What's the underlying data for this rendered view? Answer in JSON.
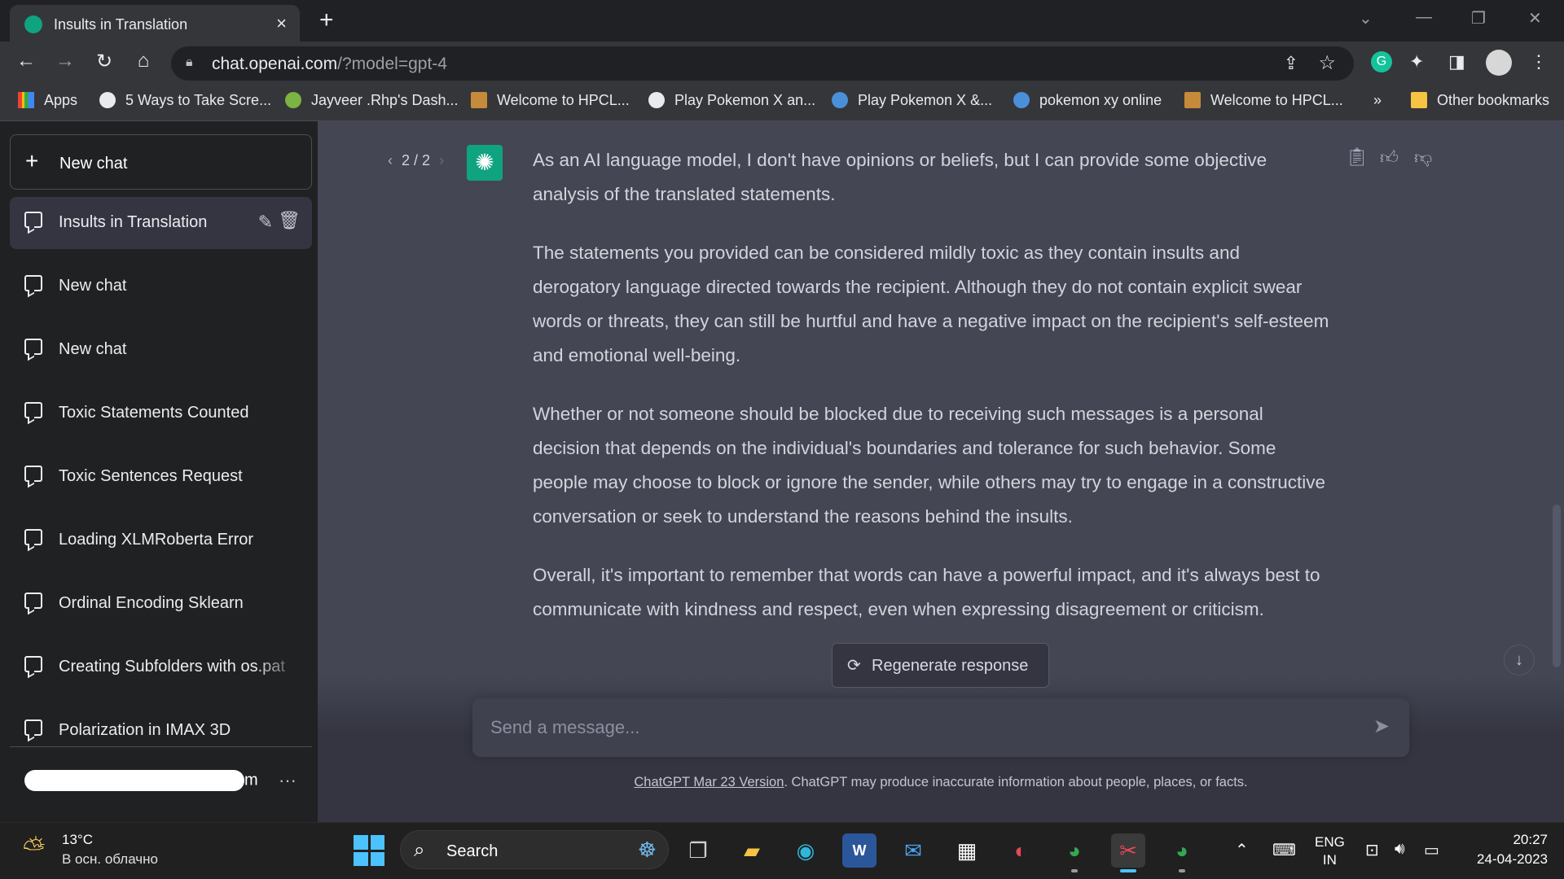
{
  "browser": {
    "tab_title": "Insults in Translation",
    "url_host": "chat.openai.com",
    "url_path": "/?model=gpt-4",
    "bookmarks": [
      {
        "label": "Apps",
        "color": "#ea4335"
      },
      {
        "label": "5 Ways to Take Scre...",
        "color": "#e8eaed"
      },
      {
        "label": "Jayveer .Rhp's Dash...",
        "color": "#7cb342"
      },
      {
        "label": "Welcome to HPCL...",
        "color": "#c58b3a"
      },
      {
        "label": "Play Pokemon X an...",
        "color": "#e8eaed"
      },
      {
        "label": "Play Pokemon X &...",
        "color": "#4a90d9"
      },
      {
        "label": "pokemon xy online",
        "color": "#4a90d9"
      },
      {
        "label": "Welcome to HPCL...",
        "color": "#c58b3a"
      }
    ],
    "bookmarks_overflow": "»",
    "other_bookmarks": "Other bookmarks"
  },
  "sidebar": {
    "new_chat": "New chat",
    "chats": [
      {
        "label": "Insults in Translation",
        "active": true
      },
      {
        "label": "New chat"
      },
      {
        "label": "New chat"
      },
      {
        "label": "Toxic Statements Counted"
      },
      {
        "label": "Toxic Sentences Request"
      },
      {
        "label": "Loading XLMRoberta Error"
      },
      {
        "label": "Ordinal Encoding Sklearn"
      },
      {
        "label": "Creating Subfolders with os.pat"
      },
      {
        "label": "Polarization in IMAX 3D"
      }
    ],
    "account_suffix": "m",
    "more": "···"
  },
  "main": {
    "pager": "2 / 2",
    "paragraphs": [
      "As an AI language model, I don't have opinions or beliefs, but I can provide some objective analysis of the translated statements.",
      "The statements you provided can be considered mildly toxic as they contain insults and derogatory language directed towards the recipient. Although they do not contain explicit swear words or threats, they can still be hurtful and have a negative impact on the recipient's self-esteem and emotional well-being.",
      "Whether or not someone should be blocked due to receiving such messages is a personal decision that depends on the individual's boundaries and tolerance for such behavior. Some people may choose to block or ignore the sender, while others may try to engage in a constructive conversation or seek to understand the reasons behind the insults.",
      "Overall, it's important to remember that words can have a powerful impact, and it's always best to communicate with kindness and respect, even when expressing disagreement or criticism."
    ],
    "regenerate": "Regenerate response",
    "input_placeholder": "Send a message...",
    "footer_link": "ChatGPT Mar 23 Version",
    "footer_text": ". ChatGPT may produce inaccurate information about people, places, or facts."
  },
  "taskbar": {
    "temp": "13°C",
    "weather": "В осн. облачно",
    "search": "Search",
    "lang_top": "ENG",
    "lang_bottom": "IN",
    "time": "20:27",
    "date": "24-04-2023"
  },
  "colors": {
    "accent": "#10a37f",
    "sidebar_bg": "#202123",
    "main_bg": "#444654"
  }
}
